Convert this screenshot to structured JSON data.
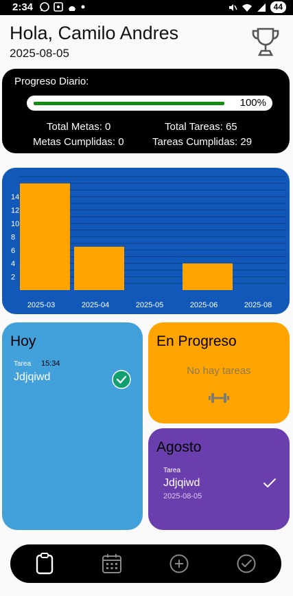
{
  "status_bar": {
    "time": "2:34",
    "battery": "44",
    "icons": [
      "whatsapp-icon",
      "screenshot-icon",
      "android-icon",
      "dot-icon",
      "mute-icon",
      "wifi-icon",
      "signal-icon",
      "battery-icon"
    ]
  },
  "header": {
    "greeting": "Hola, Camilo Andres",
    "date": "2025-08-05",
    "trophy_icon": "trophy-icon"
  },
  "progress": {
    "title": "Progreso Diario:",
    "percent_label": "100%",
    "percent_value": 1.0,
    "fill_color": "#138c13",
    "total_metas": "Total Metas: 0",
    "total_tareas": "Total Tareas: 65",
    "metas_cumplidas": "Metas Cumplidas: 0",
    "tareas_cumplidas": "Tareas Cumplidas: 29"
  },
  "chart_data": {
    "type": "bar",
    "categories": [
      "2025-03",
      "2025-04",
      "2025-05",
      "2025-06",
      "2025-08"
    ],
    "values": [
      16,
      6.5,
      0,
      4,
      0
    ],
    "yticks": [
      "2",
      "4",
      "6",
      "8",
      "10",
      "12",
      "14"
    ],
    "ylim": [
      0,
      17
    ],
    "bar_color": "#ffa400",
    "background": "#1158b8",
    "grid": true
  },
  "cards": {
    "hoy": {
      "title": "Hoy",
      "task_type": "Tarea",
      "task_time": "15:34",
      "task_name": "Jdjqiwd",
      "status_icon": "check-circle-icon"
    },
    "en_progreso": {
      "title": "En Progreso",
      "empty_text": "No hay tareas",
      "icon": "dumbbell-icon"
    },
    "agosto": {
      "title": "Agosto",
      "task_type": "Tarea",
      "task_name": "Jdjqiwd",
      "task_date": "2025-08-05",
      "status_icon": "check-icon"
    }
  },
  "nav": {
    "items": [
      "clipboard-icon",
      "calendar-icon",
      "add-circle-icon",
      "check-circle-icon"
    ]
  },
  "colors": {
    "hoy": "#42a0da",
    "en_progreso": "#ffa400",
    "agosto": "#6a3fad"
  }
}
